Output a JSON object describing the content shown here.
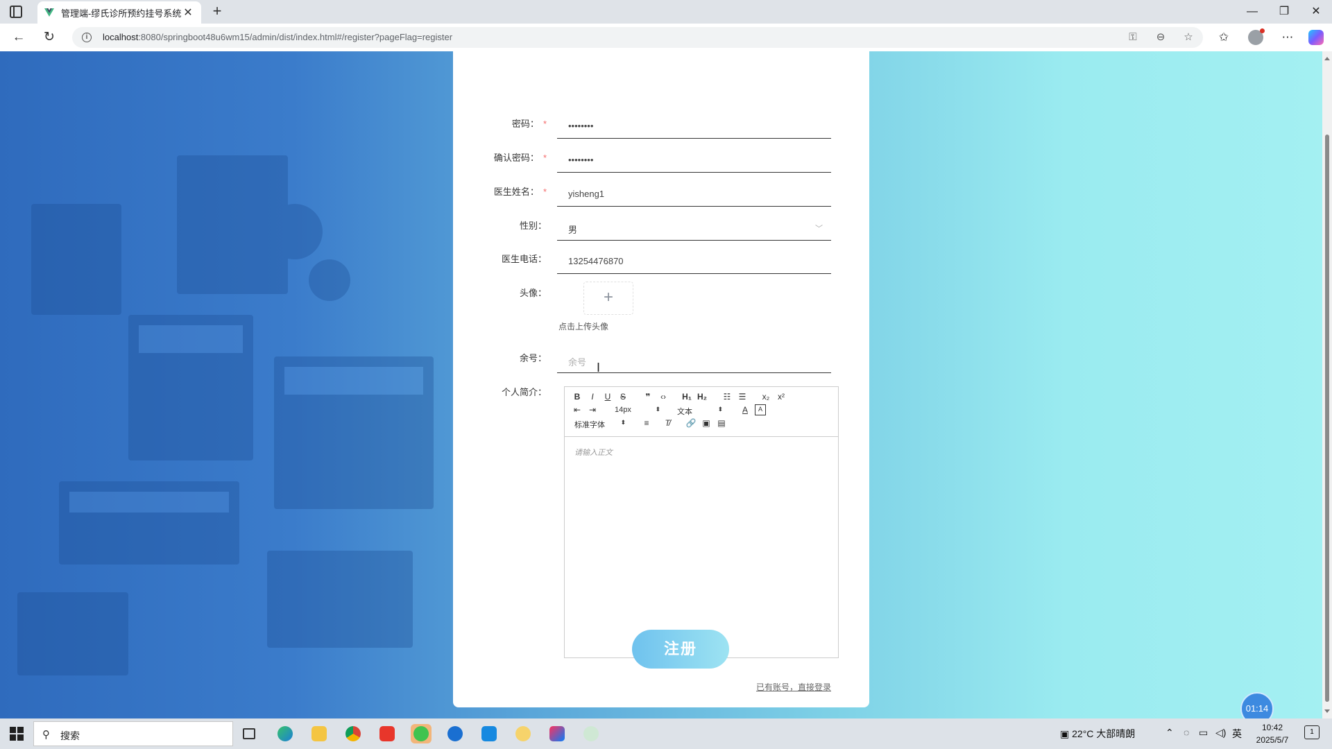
{
  "browser": {
    "tab_title": "管理端-缪氏诊所预约挂号系统",
    "url_host": "localhost",
    "url_path": ":8080/springboot48u6wm15/admin/dist/index.html#/register?pageFlag=register"
  },
  "form": {
    "password": {
      "label": "密码：",
      "value": "••••••••"
    },
    "confirm_password": {
      "label": "确认密码：",
      "value": "••••••••"
    },
    "doctor_name": {
      "label": "医生姓名：",
      "value": "yisheng1"
    },
    "gender": {
      "label": "性别：",
      "value": "男"
    },
    "phone": {
      "label": "医生电话：",
      "value": "13254476870"
    },
    "avatar": {
      "label": "头像：",
      "upload_glyph": "+",
      "tip": "点击上传头像"
    },
    "balance": {
      "label": "余号：",
      "placeholder": "余号"
    },
    "intro": {
      "label": "个人简介：",
      "font_size": "14px",
      "text_type": "文本",
      "font_family": "标准字体",
      "placeholder": "请输入正文"
    },
    "required_mark": "*",
    "submit_label": "注册",
    "login_link": "已有账号，直接登录"
  },
  "recording_timer": "01:14",
  "taskbar": {
    "search_placeholder": "搜索",
    "weather": "22°C  大部晴朗",
    "ime": "英",
    "time": "10:42",
    "date": "2025/5/7",
    "notification_count": "1"
  },
  "colors": {
    "accent": "#3d8ae0",
    "required": "#f56c6c",
    "submit_start": "#6fc2ee",
    "submit_end": "#9de3f2"
  }
}
